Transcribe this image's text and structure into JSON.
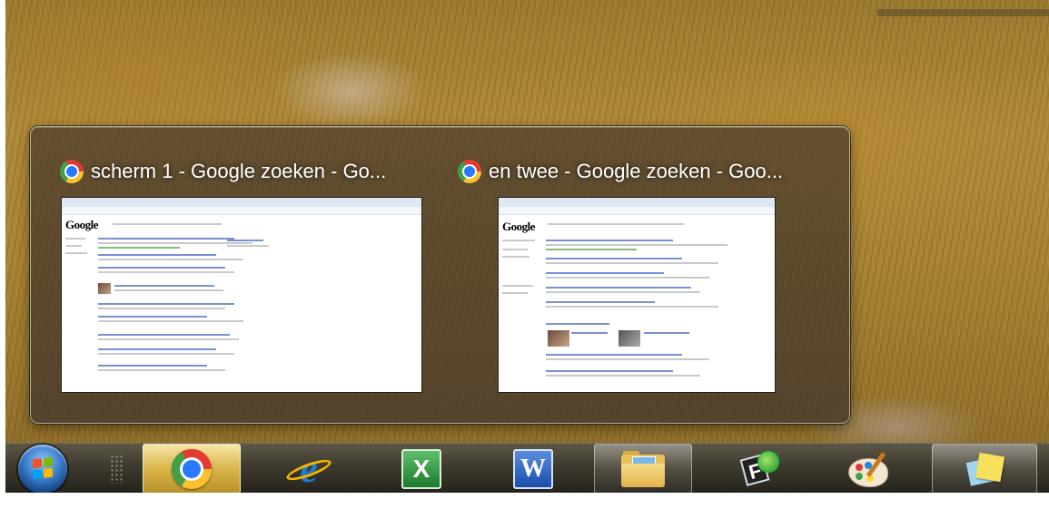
{
  "thumbnail_popup": {
    "previews": [
      {
        "title": "scherm 1 - Google zoeken - Go...",
        "icon": "chrome-icon",
        "page_logo": "Google"
      },
      {
        "title": "en twee - Google zoeken - Goo...",
        "icon": "chrome-icon",
        "page_logo": "Google"
      }
    ]
  },
  "taskbar": {
    "start_button": {
      "icon": "windows-start-orb"
    },
    "items": [
      {
        "name": "Google Chrome",
        "icon": "chrome-icon",
        "state": "active"
      },
      {
        "name": "Internet Explorer",
        "icon": "internet-explorer-icon",
        "glyph": "e",
        "state": "pinned"
      },
      {
        "name": "Microsoft Excel",
        "icon": "excel-icon",
        "glyph": "X",
        "state": "pinned"
      },
      {
        "name": "Microsoft Word",
        "icon": "word-icon",
        "glyph": "W",
        "state": "pinned"
      },
      {
        "name": "Windows Explorer",
        "icon": "folder-icon",
        "state": "open"
      },
      {
        "name": "FileZilla",
        "icon": "filezilla-icon",
        "glyph": "F",
        "state": "pinned"
      },
      {
        "name": "Paint",
        "icon": "paint-icon",
        "state": "pinned"
      },
      {
        "name": "Sticky Notes",
        "icon": "sticky-notes-icon",
        "state": "open"
      }
    ]
  },
  "colors": {
    "taskbar_bg": "#3e3a2e",
    "active_button": "#d9b54a",
    "popup_bg": "#4e3e2c"
  }
}
